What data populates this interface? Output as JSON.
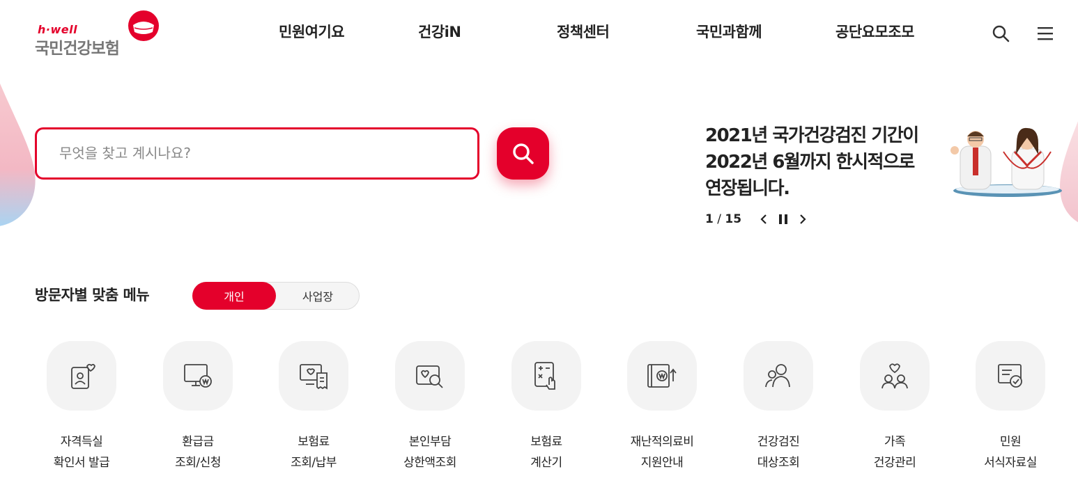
{
  "header": {
    "logo": {
      "brand": "h·well",
      "name": "국민건강보험"
    },
    "nav": [
      {
        "label": "민원여기요"
      },
      {
        "label": "건강iN"
      },
      {
        "label": "정책센터"
      },
      {
        "label": "국민과함께"
      },
      {
        "label": "공단요모조모"
      }
    ],
    "search_icon": "search-icon",
    "menu_icon": "hamburger-icon"
  },
  "search": {
    "placeholder": "무엇을 찾고 계시나요?",
    "button_icon": "search-icon"
  },
  "banner": {
    "lines": [
      "2021년 국가건강검진 기간이",
      "2022년 6월까지 한시적으로",
      "연장됩니다."
    ],
    "current": "1",
    "separator": "/",
    "total": "15",
    "prev_icon": "chevron-left-icon",
    "pause_icon": "pause-icon",
    "next_icon": "chevron-right-icon"
  },
  "visitor_menu": {
    "title": "방문자별 맞춤 메뉴",
    "toggle": {
      "active": "개인",
      "inactive": "사업장"
    },
    "items": [
      {
        "line1": "자격득실",
        "line2": "확인서 발급",
        "icon": "id-card-heart-icon"
      },
      {
        "line1": "환급금",
        "line2": "조회/신청",
        "icon": "monitor-won-icon"
      },
      {
        "line1": "보험료",
        "line2": "조회/납부",
        "icon": "monitor-receipt-icon"
      },
      {
        "line1": "본인부담",
        "line2": "상한액조회",
        "icon": "heart-search-icon"
      },
      {
        "line1": "보험료",
        "line2": "계산기",
        "icon": "calculator-hand-icon"
      },
      {
        "line1": "재난적의료비",
        "line2": "지원안내",
        "icon": "book-won-icon"
      },
      {
        "line1": "건강검진",
        "line2": "대상조회",
        "icon": "people-icon"
      },
      {
        "line1": "가족",
        "line2": "건강관리",
        "icon": "family-heart-icon"
      },
      {
        "line1": "민원",
        "line2": "서식자료실",
        "icon": "document-check-icon"
      }
    ]
  },
  "colors": {
    "accent": "#e4002b",
    "icon_bg": "#f3f3f3",
    "text": "#222222"
  }
}
